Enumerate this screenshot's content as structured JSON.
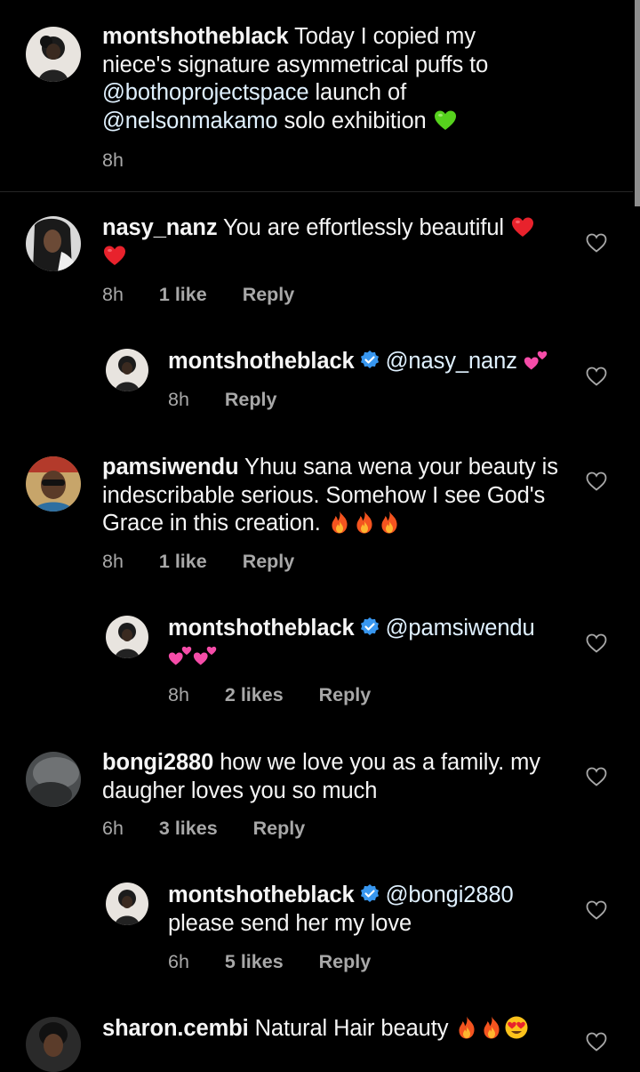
{
  "caption": {
    "username": "montshotheblack",
    "text_1": "Today I copied my niece's signature asymmetrical puffs to ",
    "mention_1": "@bothoprojectspace",
    "text_2": " launch of ",
    "mention_2": "@nelsonmakamo",
    "text_3": " solo exhibition ",
    "time": "8h"
  },
  "comments": [
    {
      "username": "nasy_nanz",
      "text": "You are effortlessly beautiful ",
      "time": "8h",
      "likes": "1 like",
      "reply": "Reply"
    },
    {
      "username": "montshotheblack",
      "mention": "@nasy_nanz",
      "text": "",
      "time": "8h",
      "likes": "",
      "reply": "Reply"
    },
    {
      "username": "pamsiwendu",
      "text": "Yhuu sana wena your beauty is indescribable serious. Somehow I see God's Grace in this creation. ",
      "time": "8h",
      "likes": "1 like",
      "reply": "Reply"
    },
    {
      "username": "montshotheblack",
      "mention": "@pamsiwendu",
      "text": "",
      "time": "8h",
      "likes": "2 likes",
      "reply": "Reply"
    },
    {
      "username": "bongi2880",
      "text": "how we love you as a family. my daugher loves you so much",
      "time": "6h",
      "likes": "3 likes",
      "reply": "Reply"
    },
    {
      "username": "montshotheblack",
      "mention": "@bongi2880",
      "text": "please send her my love",
      "time": "6h",
      "likes": "5 likes",
      "reply": "Reply"
    },
    {
      "username": "sharon.cembi",
      "text": "Natural Hair beauty ",
      "time": "",
      "likes": "",
      "reply": ""
    }
  ],
  "icons": {
    "heart_outline": "heart-outline-icon",
    "verified": "verified-badge-icon",
    "green_heart": "green-heart-emoji",
    "red_heart": "red-heart-emoji",
    "two_hearts": "two-hearts-emoji",
    "fire": "fire-emoji",
    "heart_eyes": "heart-eyes-emoji"
  },
  "colors": {
    "background": "#000000",
    "text": "#f5f5f5",
    "secondary_text": "#a8a8a8",
    "verified_blue": "#3897f0",
    "divider": "#262626"
  }
}
